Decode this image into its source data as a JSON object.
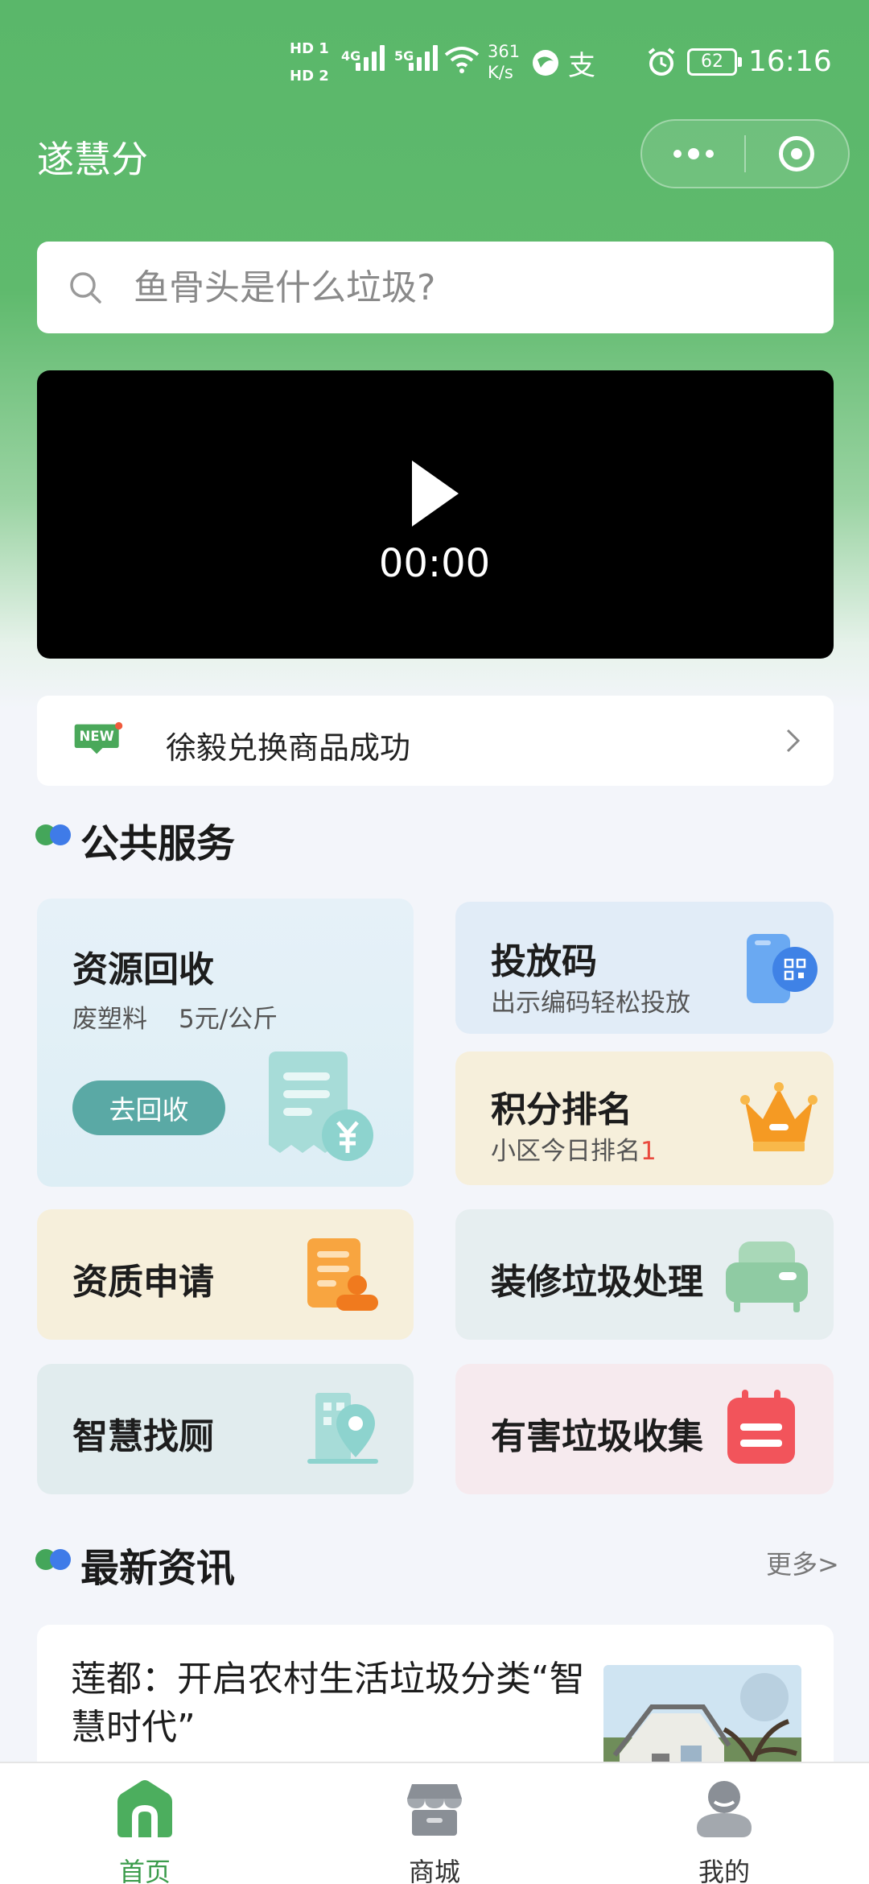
{
  "status_bar": {
    "hd1": "HD 1",
    "hd2": "HD 2",
    "net1": "4G",
    "net2": "5G",
    "speed_value": "361",
    "speed_unit": "K/s",
    "alipay": "支",
    "battery": "62",
    "time": "16:16"
  },
  "header": {
    "app_title": "遂慧分"
  },
  "search": {
    "placeholder": "鱼骨头是什么垃圾?"
  },
  "video": {
    "time": "00:00"
  },
  "notice": {
    "badge": "NEW",
    "text": "徐毅兑换商品成功"
  },
  "public_services": {
    "title": "公共服务",
    "recycle": {
      "title": "资源回收",
      "item": "废塑料",
      "price": "5元/公斤",
      "button": "去回收"
    },
    "drop_code": {
      "title": "投放码",
      "sub": "出示编码轻松投放"
    },
    "ranking": {
      "title": "积分排名",
      "sub_prefix": "小区今日排名",
      "rank": "1"
    },
    "qualification": {
      "title": "资质申请"
    },
    "renovation": {
      "title": "装修垃圾处理"
    },
    "toilet": {
      "title": "智慧找厕"
    },
    "hazardous": {
      "title": "有害垃圾收集"
    }
  },
  "news": {
    "title": "最新资讯",
    "more": "更多>",
    "items": [
      {
        "title": "莲都：开启农村生活垃圾分类“智慧时代”"
      }
    ]
  },
  "tabbar": {
    "items": [
      {
        "label": "首页",
        "icon": "home-icon",
        "active": true
      },
      {
        "label": "商城",
        "icon": "shop-icon",
        "active": false
      },
      {
        "label": "我的",
        "icon": "profile-icon",
        "active": false
      }
    ]
  },
  "colors": {
    "brand_green": "#5ab76a",
    "active_tab": "#3c9c4c",
    "recycle_button": "#5aa9a5",
    "rank_red": "#e94a3e"
  }
}
